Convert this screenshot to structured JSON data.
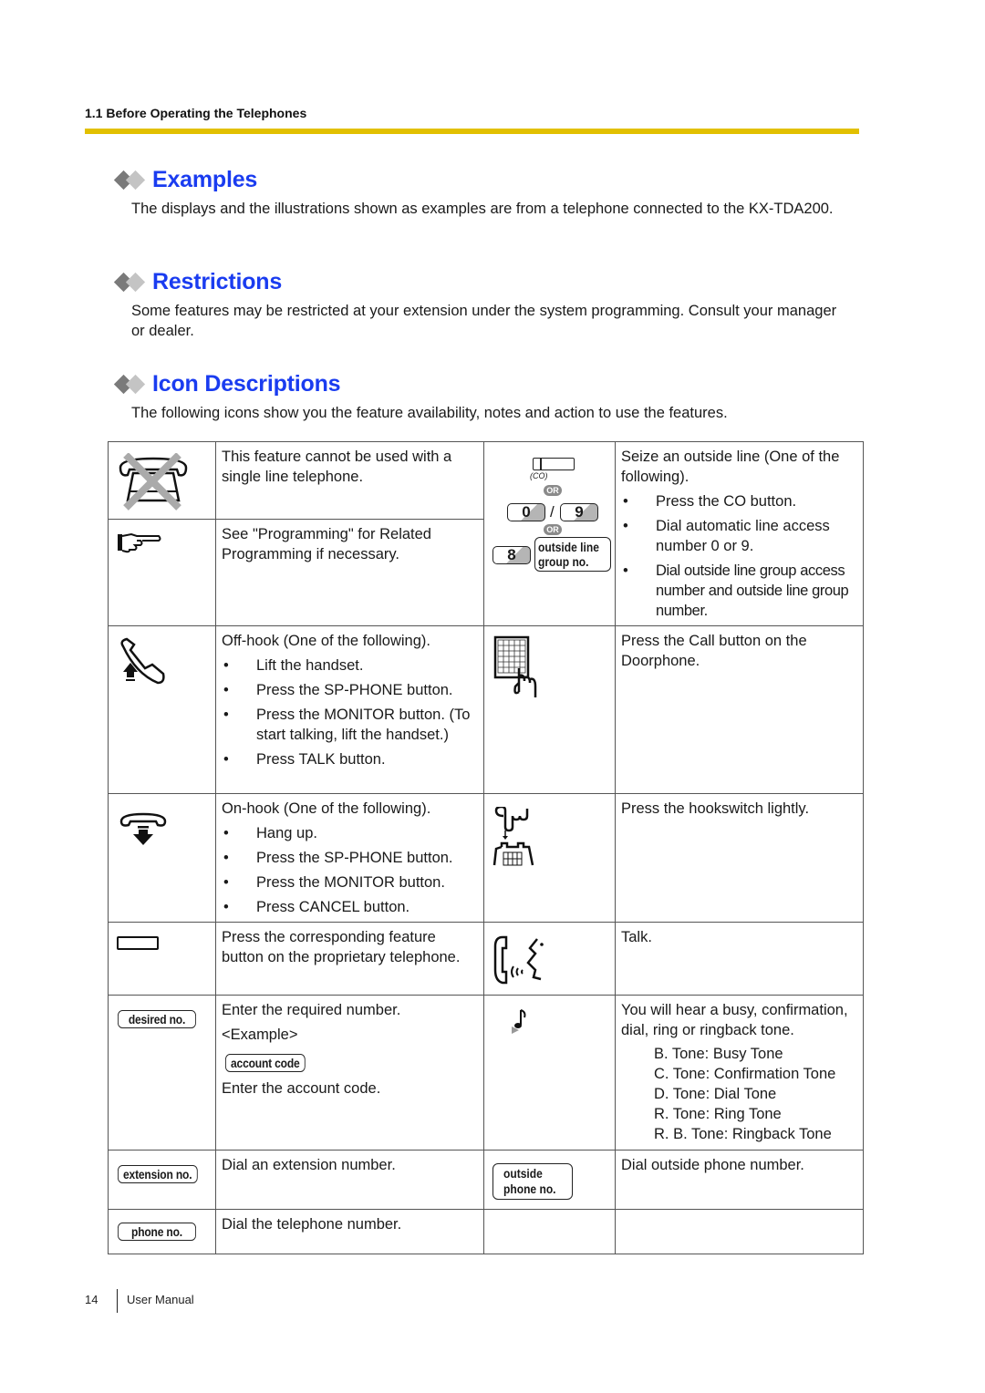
{
  "header": {
    "running_head": "1.1 Before Operating the Telephones"
  },
  "sections": {
    "examples": {
      "title": "Examples",
      "body": "The displays and the illustrations shown as examples are from a telephone connected to the KX-TDA200."
    },
    "restrictions": {
      "title": "Restrictions",
      "body": "Some features may be restricted at your extension under the system programming. Consult your manager or dealer."
    },
    "icon_descriptions": {
      "title": "Icon Descriptions",
      "body": "The following icons show you the feature availability, notes and action to use the features."
    }
  },
  "table": {
    "left": {
      "slt": {
        "icon": "single-line-telephone-crossed-icon",
        "text": "This feature cannot be used with a single line telephone."
      },
      "programming": {
        "icon": "pointing-hand-icon",
        "text": "See \"Programming\" for Related Programming if necessary."
      },
      "offhook": {
        "icon": "handset-lift-icon",
        "intro": "Off-hook (One of the following).",
        "items": [
          "Lift the handset.",
          "Press the SP-PHONE button.",
          "Press the MONITOR button. (To start talking, lift the handset.)",
          "Press TALK button."
        ]
      },
      "onhook": {
        "icon": "handset-hangup-icon",
        "intro": "On-hook (One of the following).",
        "items": [
          "Hang up.",
          "Press the SP-PHONE button.",
          "Press the MONITOR button.",
          "Press CANCEL button."
        ]
      },
      "feature_button": {
        "icon": "feature-button-icon",
        "text": "Press the corresponding feature button on the proprietary telephone."
      },
      "desired_no": {
        "pill": "desired no.",
        "line1": "Enter the required number.",
        "example_label": "<Example>",
        "example_pill": "account code",
        "example_text": "Enter the account code."
      },
      "extension_no": {
        "pill": "extension no.",
        "text": "Dial an extension number."
      },
      "phone_no": {
        "pill": "phone no.",
        "text": "Dial the telephone number."
      }
    },
    "right": {
      "outside_line": {
        "co_label": "(CO)",
        "or_label": "OR",
        "key_0": "0",
        "slash": "/",
        "key_9": "9",
        "key_8": "8",
        "group_pill_line1": "outside line",
        "group_pill_line2": "group no.",
        "intro": "Seize an outside line (One of the following).",
        "items": [
          "Press the CO button.",
          "Dial automatic line access number 0 or 9.",
          "Dial outside line group access number and outside line group number."
        ]
      },
      "doorphone": {
        "icon": "doorphone-press-icon",
        "text": "Press the Call button on the Doorphone."
      },
      "hookswitch": {
        "icon": "hookswitch-press-icon",
        "text": "Press the hookswitch lightly."
      },
      "talk": {
        "icon": "talk-icon",
        "text": "Talk."
      },
      "tone": {
        "icon": "tone-note-icon",
        "text": "You will hear a busy, confirmation, dial, ring or ringback tone.",
        "tones": [
          "B. Tone: Busy Tone",
          "C. Tone: Confirmation Tone",
          "D. Tone: Dial Tone",
          "R. Tone: Ring Tone",
          "R. B. Tone: Ringback Tone"
        ]
      },
      "outside_phone": {
        "pill_line1": "outside",
        "pill_line2": "phone no.",
        "text": "Dial outside phone number."
      }
    }
  },
  "footer": {
    "page_number": "14",
    "label": "User Manual"
  },
  "colors": {
    "heading_blue": "#1a3cf0",
    "rule_yellow": "#e2c000"
  }
}
